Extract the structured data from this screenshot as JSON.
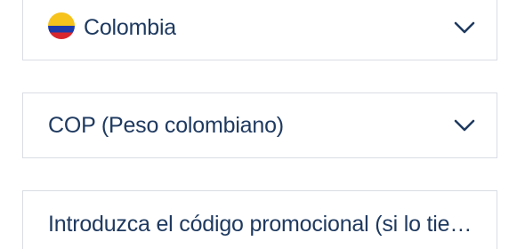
{
  "country_select": {
    "selected": "Colombia",
    "flag_icon": "colombia-flag-icon",
    "flag_colors": [
      "#f6c21c",
      "#1e3aa8",
      "#d8262e"
    ],
    "chevron_icon": "chevron-down-icon"
  },
  "currency_select": {
    "selected": "COP (Peso colombiano)",
    "chevron_icon": "chevron-down-icon"
  },
  "promo_input": {
    "placeholder": "Introduzca el código promocional (si lo tie…"
  },
  "colors": {
    "text": "#1f3a60",
    "border": "#d9dde3",
    "background": "#ffffff"
  }
}
